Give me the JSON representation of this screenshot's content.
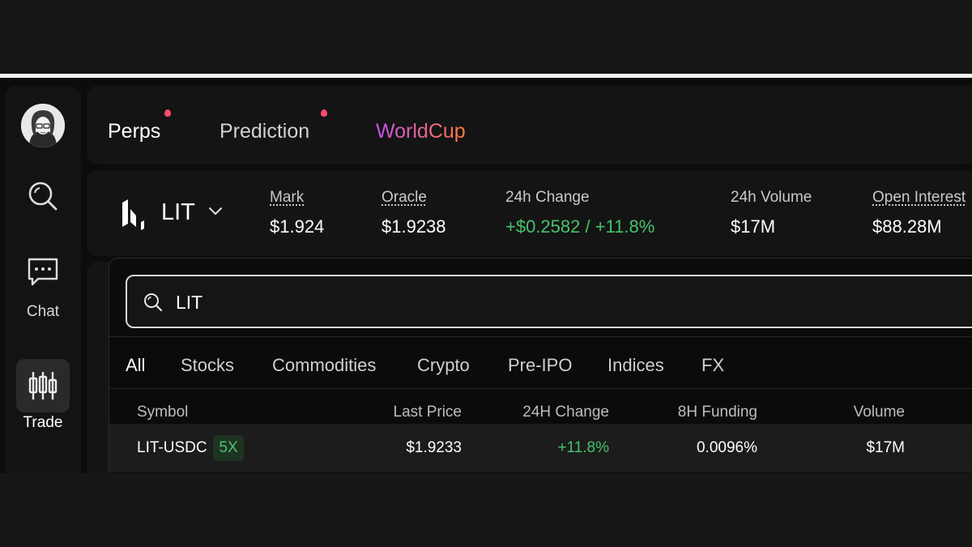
{
  "nav": {
    "items": [
      {
        "label": "Chat"
      },
      {
        "label": "Trade"
      }
    ]
  },
  "tabs": [
    {
      "label": "Perps"
    },
    {
      "label": "Prediction"
    },
    {
      "label": "WorldCup"
    }
  ],
  "market": {
    "symbol": "LIT",
    "stats": [
      {
        "label": "Mark",
        "value": "$1.924"
      },
      {
        "label": "Oracle",
        "value": "$1.9238"
      },
      {
        "label": "24h Change",
        "value": "+$0.2582 / +11.8%"
      },
      {
        "label": "24h Volume",
        "value": "$17M"
      },
      {
        "label": "Open Interest",
        "value": "$88.28M"
      }
    ]
  },
  "search": {
    "value": "LIT"
  },
  "filters": [
    "All",
    "Stocks",
    "Commodities",
    "Crypto",
    "Pre-IPO",
    "Indices",
    "FX"
  ],
  "table": {
    "columns": [
      "Symbol",
      "Last Price",
      "24H Change",
      "8H Funding",
      "Volume"
    ],
    "rows": [
      {
        "symbol": "LIT-USDC",
        "leverage": "5X",
        "last_price": "$1.9233",
        "change": "+11.8%",
        "funding": "0.0096%",
        "volume": "$17M"
      }
    ]
  },
  "colors": {
    "accent_green": "#46c36a",
    "worldcup_gradient": [
      "#c850f0",
      "#ff7a3d"
    ],
    "tab_dot": "#ff4d6d"
  },
  "icons": [
    "avatar",
    "search-icon",
    "chat-icon",
    "candlestick-icon",
    "lighter-logo-icon",
    "chevron-down-icon"
  ]
}
